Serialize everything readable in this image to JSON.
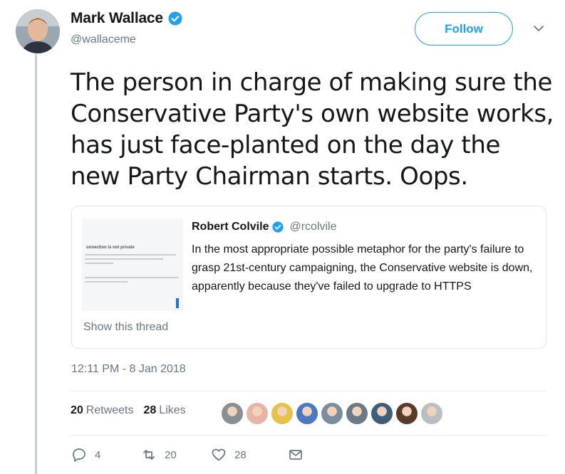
{
  "author": {
    "display_name": "Mark Wallace",
    "handle": "@wallaceme",
    "verified": true
  },
  "follow_button": {
    "label": "Follow"
  },
  "tweet": {
    "text": "The person in charge of making sure the Conservative Party's own website works, has just face-planted on the day the new Party Chairman starts. Oops.",
    "timestamp": "12:11 PM - 8 Jan 2018"
  },
  "quoted_tweet": {
    "display_name": "Robert Colvile",
    "handle": "@rcolvile",
    "verified": true,
    "text": "In the most appropriate possible metaphor for the party's failure to grasp 21st-century campaigning, the Conservative website is down, apparently because they've failed to upgrade to HTTPS",
    "thumbnail_heading": "onnection is not private",
    "show_thread_label": "Show this thread"
  },
  "stats": {
    "retweets_count": "20",
    "retweets_label": "Retweets",
    "likes_count": "28",
    "likes_label": "Likes"
  },
  "likers": [
    {
      "color": "#8a8f94"
    },
    {
      "color": "#e8b3a8"
    },
    {
      "color": "#e7c24a"
    },
    {
      "color": "#4a78c4"
    },
    {
      "color": "#7a8ea0"
    },
    {
      "color": "#6b7a86"
    },
    {
      "color": "#3d5f7a"
    },
    {
      "color": "#5a3a2a"
    },
    {
      "color": "#b9bec2"
    }
  ],
  "actions": {
    "reply_count": "4",
    "retweet_count": "20",
    "like_count": "28"
  },
  "colors": {
    "accent": "#1da1f2",
    "secondary_text": "#657786",
    "border": "#e1e8ed"
  }
}
